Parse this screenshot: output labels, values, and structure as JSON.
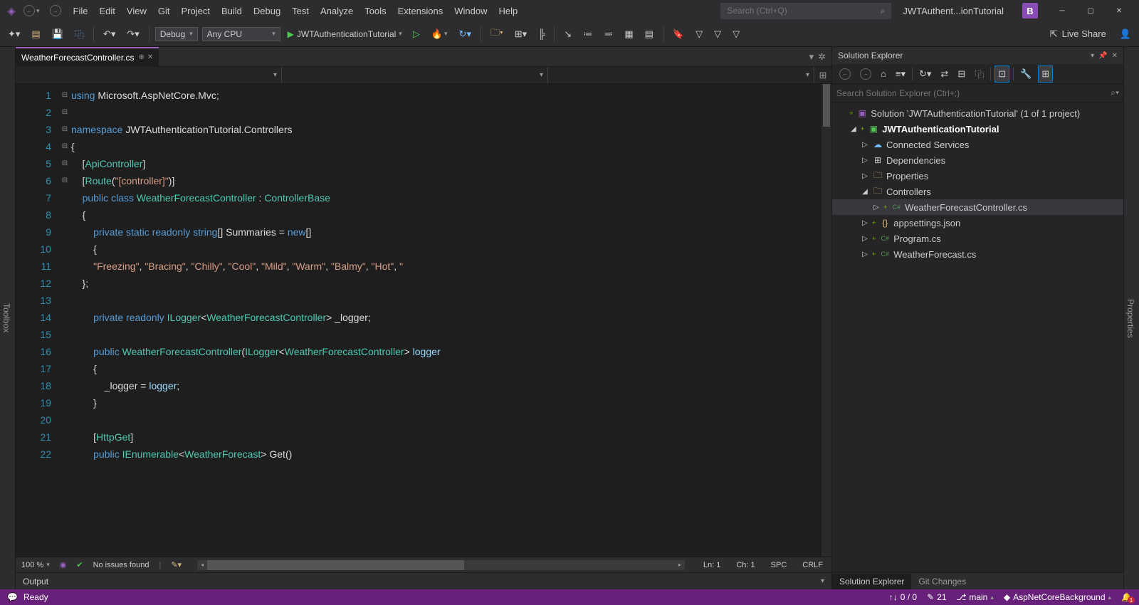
{
  "titlebar": {
    "app_title": "JWTAuthent...ionTutorial",
    "user_initial": "B",
    "search_placeholder": "Search (Ctrl+Q)"
  },
  "menu": [
    "File",
    "Edit",
    "View",
    "Git",
    "Project",
    "Build",
    "Debug",
    "Test",
    "Analyze",
    "Tools",
    "Extensions",
    "Window",
    "Help"
  ],
  "toolbar": {
    "config": "Debug",
    "platform": "Any CPU",
    "run_target": "JWTAuthenticationTutorial",
    "live_share": "Live Share"
  },
  "side": {
    "left": "Toolbox",
    "right": "Properties"
  },
  "tab": {
    "filename": "WeatherForecastController.cs"
  },
  "code": {
    "lines": [
      {
        "n": "1",
        "fold": "⊟",
        "parts": [
          {
            "t": "using ",
            "c": "kw"
          },
          {
            "t": "Microsoft.AspNetCore.Mvc;",
            "c": "ident"
          }
        ]
      },
      {
        "n": "2",
        "fold": "",
        "parts": []
      },
      {
        "n": "3",
        "fold": "⊟",
        "parts": [
          {
            "t": "namespace ",
            "c": "kw"
          },
          {
            "t": "JWTAuthenticationTutorial.Controllers",
            "c": "ident"
          }
        ]
      },
      {
        "n": "4",
        "fold": "",
        "parts": [
          {
            "t": "{",
            "c": "punc"
          }
        ]
      },
      {
        "n": "5",
        "fold": "",
        "parts": [
          {
            "t": "    [",
            "c": "punc"
          },
          {
            "t": "ApiController",
            "c": "type"
          },
          {
            "t": "]",
            "c": "punc"
          }
        ]
      },
      {
        "n": "6",
        "fold": "",
        "parts": [
          {
            "t": "    [",
            "c": "punc"
          },
          {
            "t": "Route",
            "c": "type"
          },
          {
            "t": "(",
            "c": "punc"
          },
          {
            "t": "\"[controller]\"",
            "c": "str"
          },
          {
            "t": ")]",
            "c": "punc"
          }
        ]
      },
      {
        "n": "7",
        "fold": "⊟",
        "parts": [
          {
            "t": "    ",
            "c": ""
          },
          {
            "t": "public class ",
            "c": "kw"
          },
          {
            "t": "WeatherForecastController",
            "c": "type"
          },
          {
            "t": " : ",
            "c": "punc"
          },
          {
            "t": "ControllerBase",
            "c": "type"
          }
        ]
      },
      {
        "n": "8",
        "fold": "",
        "parts": [
          {
            "t": "    {",
            "c": "punc"
          }
        ]
      },
      {
        "n": "9",
        "fold": "⊟",
        "parts": [
          {
            "t": "        ",
            "c": ""
          },
          {
            "t": "private static readonly ",
            "c": "kw"
          },
          {
            "t": "string",
            "c": "kw"
          },
          {
            "t": "[] Summaries = ",
            "c": "ident"
          },
          {
            "t": "new",
            "c": "kw"
          },
          {
            "t": "[]",
            "c": "punc"
          }
        ]
      },
      {
        "n": "10",
        "fold": "",
        "parts": [
          {
            "t": "        {",
            "c": "punc"
          }
        ]
      },
      {
        "n": "11",
        "fold": "",
        "parts": [
          {
            "t": "        ",
            "c": ""
          },
          {
            "t": "\"Freezing\"",
            "c": "str"
          },
          {
            "t": ", ",
            "c": "punc"
          },
          {
            "t": "\"Bracing\"",
            "c": "str"
          },
          {
            "t": ", ",
            "c": "punc"
          },
          {
            "t": "\"Chilly\"",
            "c": "str"
          },
          {
            "t": ", ",
            "c": "punc"
          },
          {
            "t": "\"Cool\"",
            "c": "str"
          },
          {
            "t": ", ",
            "c": "punc"
          },
          {
            "t": "\"Mild\"",
            "c": "str"
          },
          {
            "t": ", ",
            "c": "punc"
          },
          {
            "t": "\"Warm\"",
            "c": "str"
          },
          {
            "t": ", ",
            "c": "punc"
          },
          {
            "t": "\"Balmy\"",
            "c": "str"
          },
          {
            "t": ", ",
            "c": "punc"
          },
          {
            "t": "\"Hot\"",
            "c": "str"
          },
          {
            "t": ", ",
            "c": "punc"
          },
          {
            "t": "\"",
            "c": "str"
          }
        ]
      },
      {
        "n": "12",
        "fold": "",
        "parts": [
          {
            "t": "    };",
            "c": "punc"
          }
        ]
      },
      {
        "n": "13",
        "fold": "",
        "parts": []
      },
      {
        "n": "14",
        "fold": "",
        "parts": [
          {
            "t": "        ",
            "c": ""
          },
          {
            "t": "private readonly ",
            "c": "kw"
          },
          {
            "t": "ILogger",
            "c": "type"
          },
          {
            "t": "<",
            "c": "punc"
          },
          {
            "t": "WeatherForecastController",
            "c": "type"
          },
          {
            "t": "> _logger;",
            "c": "ident"
          }
        ]
      },
      {
        "n": "15",
        "fold": "",
        "parts": []
      },
      {
        "n": "16",
        "fold": "⊟",
        "parts": [
          {
            "t": "        ",
            "c": ""
          },
          {
            "t": "public ",
            "c": "kw"
          },
          {
            "t": "WeatherForecastController",
            "c": "type"
          },
          {
            "t": "(",
            "c": "punc"
          },
          {
            "t": "ILogger",
            "c": "type"
          },
          {
            "t": "<",
            "c": "punc"
          },
          {
            "t": "WeatherForecastController",
            "c": "type"
          },
          {
            "t": "> ",
            "c": "punc"
          },
          {
            "t": "logger",
            "c": "var"
          }
        ]
      },
      {
        "n": "17",
        "fold": "",
        "parts": [
          {
            "t": "        {",
            "c": "punc"
          }
        ]
      },
      {
        "n": "18",
        "fold": "",
        "parts": [
          {
            "t": "            _logger = ",
            "c": "ident"
          },
          {
            "t": "logger",
            "c": "var"
          },
          {
            "t": ";",
            "c": "punc"
          }
        ]
      },
      {
        "n": "19",
        "fold": "",
        "parts": [
          {
            "t": "        }",
            "c": "punc"
          }
        ]
      },
      {
        "n": "20",
        "fold": "",
        "parts": []
      },
      {
        "n": "21",
        "fold": "",
        "parts": [
          {
            "t": "        [",
            "c": "punc"
          },
          {
            "t": "HttpGet",
            "c": "type"
          },
          {
            "t": "]",
            "c": "punc"
          }
        ]
      },
      {
        "n": "22",
        "fold": "⊟",
        "parts": [
          {
            "t": "        ",
            "c": ""
          },
          {
            "t": "public ",
            "c": "kw"
          },
          {
            "t": "IEnumerable",
            "c": "type"
          },
          {
            "t": "<",
            "c": "punc"
          },
          {
            "t": "WeatherForecast",
            "c": "type"
          },
          {
            "t": "> ",
            "c": "punc"
          },
          {
            "t": "Get",
            "c": "ident"
          },
          {
            "t": "()",
            "c": "punc"
          }
        ]
      }
    ]
  },
  "editor_status": {
    "zoom": "100 %",
    "issues": "No issues found",
    "ln": "Ln: 1",
    "ch": "Ch: 1",
    "indent": "SPC",
    "eol": "CRLF"
  },
  "panel": {
    "title": "Solution Explorer",
    "search_placeholder": "Search Solution Explorer (Ctrl+;)",
    "tabs": [
      "Solution Explorer",
      "Git Changes"
    ]
  },
  "tree": [
    {
      "depth": 0,
      "exp": "",
      "icon": "sln",
      "label": "Solution 'JWTAuthenticationTutorial' (1 of 1 project)",
      "git": "+",
      "bold": false,
      "sel": false
    },
    {
      "depth": 1,
      "exp": "◢",
      "icon": "proj",
      "label": "JWTAuthenticationTutorial",
      "git": "+",
      "bold": true,
      "sel": false
    },
    {
      "depth": 2,
      "exp": "▷",
      "icon": "connected",
      "label": "Connected Services",
      "git": "",
      "bold": false,
      "sel": false
    },
    {
      "depth": 2,
      "exp": "▷",
      "icon": "deps",
      "label": "Dependencies",
      "git": "",
      "bold": false,
      "sel": false
    },
    {
      "depth": 2,
      "exp": "▷",
      "icon": "folder",
      "label": "Properties",
      "git": "",
      "bold": false,
      "sel": false
    },
    {
      "depth": 2,
      "exp": "◢",
      "icon": "folder",
      "label": "Controllers",
      "git": "",
      "bold": false,
      "sel": false
    },
    {
      "depth": 3,
      "exp": "▷",
      "icon": "cs",
      "label": "WeatherForecastController.cs",
      "git": "+",
      "bold": false,
      "sel": true
    },
    {
      "depth": 2,
      "exp": "▷",
      "icon": "json",
      "label": "appsettings.json",
      "git": "+",
      "bold": false,
      "sel": false
    },
    {
      "depth": 2,
      "exp": "▷",
      "icon": "cs",
      "label": "Program.cs",
      "git": "+",
      "bold": false,
      "sel": false
    },
    {
      "depth": 2,
      "exp": "▷",
      "icon": "cs",
      "label": "WeatherForecast.cs",
      "git": "+",
      "bold": false,
      "sel": false
    }
  ],
  "output": {
    "label": "Output"
  },
  "statusbar": {
    "ready": "Ready",
    "updown": "0 / 0",
    "changes": "21",
    "branch": "main",
    "repo": "AspNetCoreBackground"
  }
}
